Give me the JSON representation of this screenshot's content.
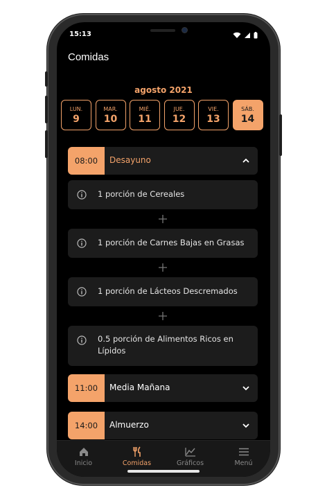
{
  "status": {
    "time": "15:13"
  },
  "header": {
    "title": "Comidas"
  },
  "calendar": {
    "month": "agosto 2021",
    "days": [
      {
        "name": "LUN.",
        "num": "9"
      },
      {
        "name": "MAR.",
        "num": "10"
      },
      {
        "name": "MIÉ.",
        "num": "11"
      },
      {
        "name": "JUE.",
        "num": "12"
      },
      {
        "name": "VIE.",
        "num": "13"
      },
      {
        "name": "SÁB.",
        "num": "14"
      }
    ],
    "selected_index": 5
  },
  "meals": [
    {
      "time": "08:00",
      "name": "Desayuno",
      "expanded": true
    },
    {
      "time": "11:00",
      "name": "Media Mañana",
      "expanded": false
    },
    {
      "time": "14:00",
      "name": "Almuerzo",
      "expanded": false
    }
  ],
  "portions": [
    "1 porción de Cereales",
    "1 porción de Carnes Bajas en Grasas",
    "1 porción de Lácteos Descremados",
    "0.5 porción de Alimentos Ricos en Lípidos"
  ],
  "tabs": [
    {
      "label": "Inicio",
      "icon": "home-icon"
    },
    {
      "label": "Comidas",
      "icon": "fork-knife-icon"
    },
    {
      "label": "Gráficos",
      "icon": "chart-icon"
    },
    {
      "label": "Menú",
      "icon": "menu-icon"
    }
  ],
  "active_tab": "Comidas",
  "colors": {
    "accent": "#f4a36a",
    "background": "#000000",
    "card": "#1c1c1c"
  }
}
